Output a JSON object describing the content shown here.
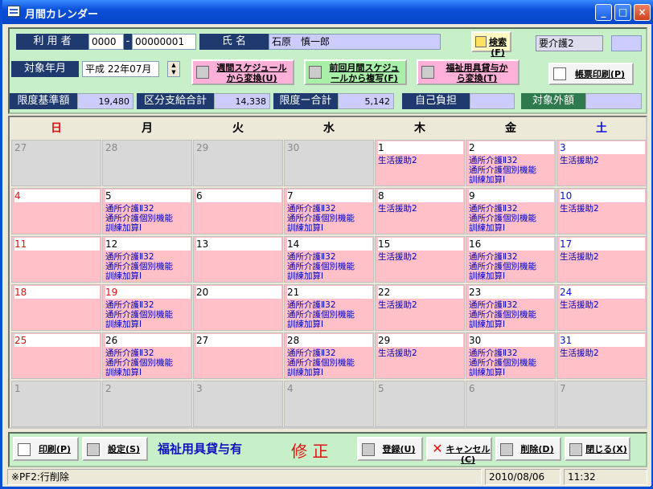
{
  "window": {
    "title": "月間カレンダー"
  },
  "header": {
    "user_label": "利 用 者",
    "user_code1": "0000",
    "user_code2": "00000001",
    "name_label": "氏 名",
    "name_value": "石原　慎一郎",
    "search_button": "検索(F)",
    "care_level": "要介護2",
    "care_level_extra": "",
    "target_month_label": "対象年月",
    "target_month_value": "平成 22年07月",
    "btn_weekly": [
      "週間スケジュール",
      "から変換(U)"
    ],
    "btn_prev_month": [
      "前回月間スケジュ",
      "ールから複写(F)"
    ],
    "btn_welfare": [
      "福祉用具貸与か",
      "ら変換(T)"
    ],
    "btn_report_print": "帳票印刷(P)",
    "limit_base_label": "限度基準額",
    "limit_base_value": "19,480",
    "category_total_label": "区分支給合計",
    "category_total_value": "14,338",
    "limit_total_label": "限度ー合計",
    "limit_total_value": "5,142",
    "self_pay_label": "自己負担",
    "self_pay_value": "",
    "excluded_label": "対象外額",
    "excluded_value": ""
  },
  "calendar": {
    "weekdays": [
      "日",
      "月",
      "火",
      "水",
      "木",
      "金",
      "土"
    ],
    "weekday_colors": [
      "#e01010",
      "#000000",
      "#000000",
      "#000000",
      "#000000",
      "#000000",
      "#1010e0"
    ],
    "weeks": [
      [
        {
          "day": "27",
          "in": false,
          "items": []
        },
        {
          "day": "28",
          "in": false,
          "items": []
        },
        {
          "day": "29",
          "in": false,
          "items": []
        },
        {
          "day": "30",
          "in": false,
          "items": []
        },
        {
          "day": "1",
          "in": true,
          "items": [
            "生活援助2"
          ]
        },
        {
          "day": "2",
          "in": true,
          "items": [
            "通所介護Ⅱ32",
            "通所介護個別機能",
            "訓練加算Ⅰ"
          ]
        },
        {
          "day": "3",
          "in": true,
          "items": [
            "生活援助2"
          ]
        }
      ],
      [
        {
          "day": "4",
          "in": true,
          "items": []
        },
        {
          "day": "5",
          "in": true,
          "items": [
            "通所介護Ⅱ32",
            "通所介護個別機能",
            "訓練加算Ⅰ"
          ]
        },
        {
          "day": "6",
          "in": true,
          "items": []
        },
        {
          "day": "7",
          "in": true,
          "items": [
            "通所介護Ⅱ32",
            "通所介護個別機能",
            "訓練加算Ⅰ"
          ]
        },
        {
          "day": "8",
          "in": true,
          "items": [
            "生活援助2"
          ]
        },
        {
          "day": "9",
          "in": true,
          "items": [
            "通所介護Ⅱ32",
            "通所介護個別機能",
            "訓練加算Ⅰ"
          ]
        },
        {
          "day": "10",
          "in": true,
          "items": [
            "生活援助2"
          ]
        }
      ],
      [
        {
          "day": "11",
          "in": true,
          "items": []
        },
        {
          "day": "12",
          "in": true,
          "items": [
            "通所介護Ⅱ32",
            "通所介護個別機能",
            "訓練加算Ⅰ"
          ]
        },
        {
          "day": "13",
          "in": true,
          "items": []
        },
        {
          "day": "14",
          "in": true,
          "items": [
            "通所介護Ⅱ32",
            "通所介護個別機能",
            "訓練加算Ⅰ"
          ]
        },
        {
          "day": "15",
          "in": true,
          "items": [
            "生活援助2"
          ]
        },
        {
          "day": "16",
          "in": true,
          "items": [
            "通所介護Ⅱ32",
            "通所介護個別機能",
            "訓練加算Ⅰ"
          ]
        },
        {
          "day": "17",
          "in": true,
          "items": [
            "生活援助2"
          ]
        }
      ],
      [
        {
          "day": "18",
          "in": true,
          "items": []
        },
        {
          "day": "19",
          "in": true,
          "items": [
            "通所介護Ⅱ32",
            "通所介護個別機能",
            "訓練加算Ⅰ"
          ],
          "holiday": true
        },
        {
          "day": "20",
          "in": true,
          "items": []
        },
        {
          "day": "21",
          "in": true,
          "items": [
            "通所介護Ⅱ32",
            "通所介護個別機能",
            "訓練加算Ⅰ"
          ]
        },
        {
          "day": "22",
          "in": true,
          "items": [
            "生活援助2"
          ]
        },
        {
          "day": "23",
          "in": true,
          "items": [
            "通所介護Ⅱ32",
            "通所介護個別機能",
            "訓練加算Ⅰ"
          ]
        },
        {
          "day": "24",
          "in": true,
          "items": [
            "生活援助2"
          ]
        }
      ],
      [
        {
          "day": "25",
          "in": true,
          "items": []
        },
        {
          "day": "26",
          "in": true,
          "items": [
            "通所介護Ⅱ32",
            "通所介護個別機能",
            "訓練加算Ⅰ"
          ]
        },
        {
          "day": "27",
          "in": true,
          "items": []
        },
        {
          "day": "28",
          "in": true,
          "items": [
            "通所介護Ⅱ32",
            "通所介護個別機能",
            "訓練加算Ⅰ"
          ]
        },
        {
          "day": "29",
          "in": true,
          "items": [
            "生活援助2"
          ]
        },
        {
          "day": "30",
          "in": true,
          "items": [
            "通所介護Ⅱ32",
            "通所介護個別機能",
            "訓練加算Ⅰ"
          ]
        },
        {
          "day": "31",
          "in": true,
          "items": [
            "生活援助2"
          ]
        }
      ],
      [
        {
          "day": "1",
          "in": false,
          "items": []
        },
        {
          "day": "2",
          "in": false,
          "items": []
        },
        {
          "day": "3",
          "in": false,
          "items": []
        },
        {
          "day": "4",
          "in": false,
          "items": []
        },
        {
          "day": "5",
          "in": false,
          "items": []
        },
        {
          "day": "6",
          "in": false,
          "items": []
        },
        {
          "day": "7",
          "in": false,
          "items": []
        }
      ]
    ]
  },
  "footer": {
    "print_button": "印刷(P)",
    "settings_button": "設定(S)",
    "welfare_status": "福祉用具貸与有",
    "mode_label": "修 正",
    "register_button": "登録(U)",
    "cancel_button": "キャンセル(C)",
    "delete_button": "削除(D)",
    "close_button": "閉じる(X)"
  },
  "statusbar": {
    "hint": "※PF2:行削除",
    "date": "2010/08/06",
    "time": "11:32"
  }
}
